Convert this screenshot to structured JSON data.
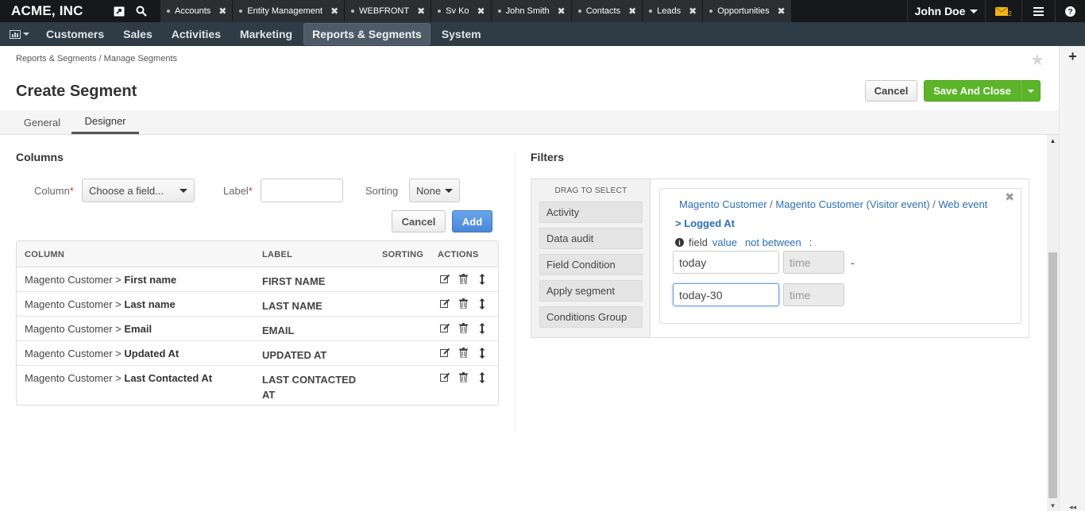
{
  "brand": "ACME, INC",
  "top_tabs": [
    {
      "label": "Accounts"
    },
    {
      "label": "Entity Management"
    },
    {
      "label": "WEBFRONT"
    },
    {
      "label": "Sv Ko"
    },
    {
      "label": "John Smith"
    },
    {
      "label": "Contacts"
    },
    {
      "label": "Leads"
    },
    {
      "label": "Opportunities"
    }
  ],
  "user": {
    "name": "John Doe",
    "mail_count": "2"
  },
  "nav": {
    "items": [
      "Customers",
      "Sales",
      "Activities",
      "Marketing",
      "Reports & Segments",
      "System"
    ],
    "active": "Reports & Segments"
  },
  "breadcrumb": "Reports & Segments / Manage Segments",
  "page_title": "Create Segment",
  "actions": {
    "cancel": "Cancel",
    "save": "Save And Close"
  },
  "page_tabs": {
    "general": "General",
    "designer": "Designer"
  },
  "columns": {
    "title": "Columns",
    "column_label": "Column",
    "column_placeholder": "Choose a field...",
    "label_label": "Label",
    "label_value": "",
    "sorting_label": "Sorting",
    "sorting_value": "None",
    "cancel": "Cancel",
    "add": "Add",
    "headers": {
      "column": "COLUMN",
      "label": "LABEL",
      "sorting": "SORTING",
      "actions": "ACTIONS"
    },
    "rows": [
      {
        "entity": "Magento Customer",
        "field": "First name",
        "label": "FIRST NAME"
      },
      {
        "entity": "Magento Customer",
        "field": "Last name",
        "label": "LAST NAME"
      },
      {
        "entity": "Magento Customer",
        "field": "Email",
        "label": "EMAIL"
      },
      {
        "entity": "Magento Customer",
        "field": "Updated At",
        "label": "UPDATED AT"
      },
      {
        "entity": "Magento Customer",
        "field": "Last Contacted At",
        "label": "LAST CONTACTED AT"
      }
    ]
  },
  "filters": {
    "title": "Filters",
    "palette_title": "DRAG TO SELECT",
    "criteria": [
      "Activity",
      "Data audit",
      "Field Condition",
      "Apply segment",
      "Conditions Group"
    ],
    "condition": {
      "path": [
        "Magento Customer",
        "Magento Customer (Visitor event)",
        "Web event"
      ],
      "field": "> Logged At",
      "prefix": "field",
      "value_word": "value",
      "operator": "not between",
      "suffix": ":",
      "start_value": "today",
      "start_time_placeholder": "time",
      "end_value": "today-30",
      "end_time_placeholder": "time",
      "range_sep": "-"
    }
  }
}
